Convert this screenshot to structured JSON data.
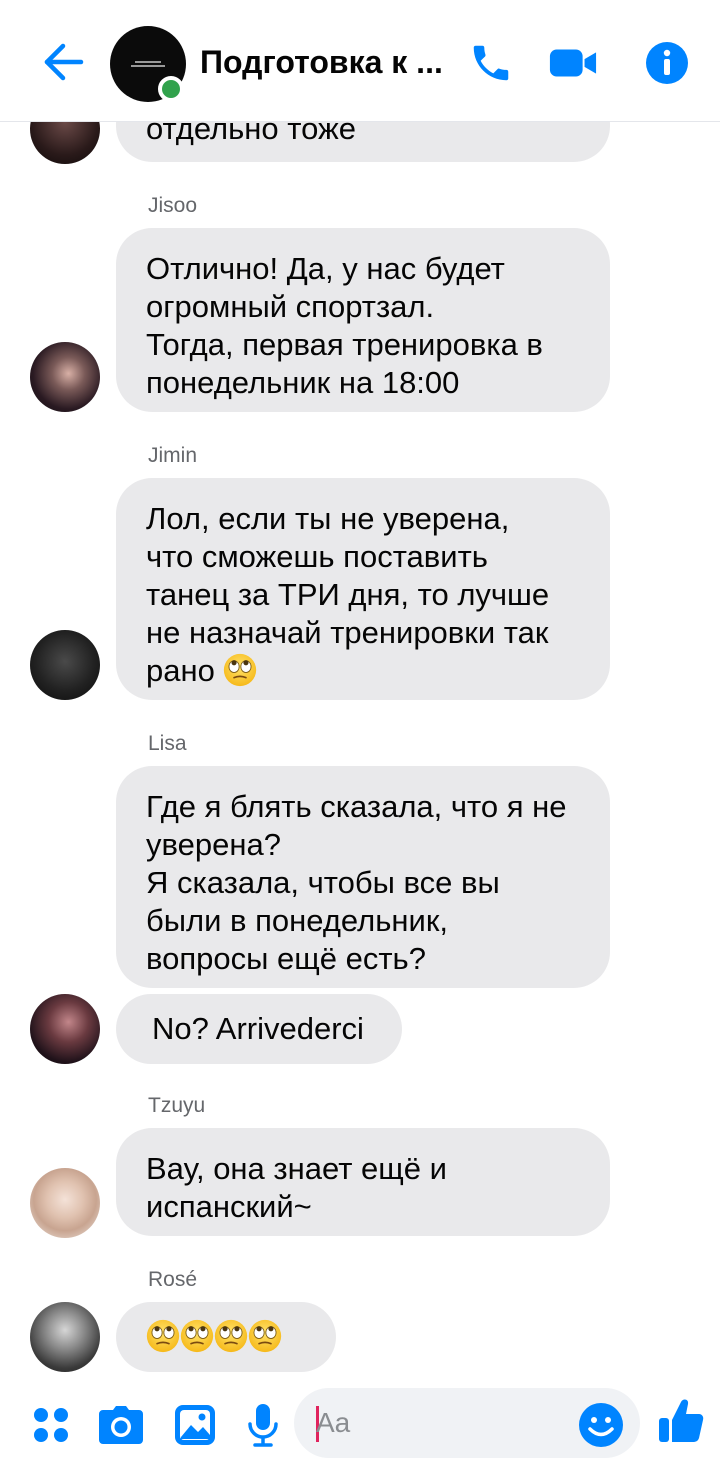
{
  "header": {
    "title": "Подготовка к ...",
    "back_icon": "arrow-left-icon",
    "call_icon": "phone-icon",
    "video_icon": "video-camera-icon",
    "info_icon": "info-icon",
    "accent_color": "#0084ff",
    "online_color": "#31a24c"
  },
  "messages": [
    {
      "sender": "",
      "lines": [
        "отдельно тоже"
      ]
    },
    {
      "sender": "Jisoo",
      "lines": [
        "Отлично! Да, у нас будет",
        "огромный спортзал.",
        "Тогда, первая тренировка в",
        "понедельник на 18:00"
      ]
    },
    {
      "sender": "Jimin",
      "lines": [
        "Лол, если ты не уверена,",
        "что сможешь поставить",
        "танец за ТРИ дня, то лучше",
        "не назначай тренировки так",
        "рано"
      ],
      "trailing_emoji": "rolling-eyes-emoji"
    },
    {
      "sender": "Lisa",
      "lines": [
        "Где я блять сказала, что я не",
        "уверена?",
        "Я сказала, чтобы все вы",
        "были в понедельник,",
        "вопросы ещё есть?"
      ]
    },
    {
      "sender": "",
      "lines": [
        "No? Arrivederci"
      ]
    },
    {
      "sender": "Tzuyu",
      "lines": [
        "Вау, она знает ещё и",
        "испанский~"
      ]
    },
    {
      "sender": "Rosé",
      "lines": [
        ""
      ],
      "emojis": [
        "rolling-eyes-emoji",
        "rolling-eyes-emoji",
        "rolling-eyes-emoji",
        "rolling-eyes-emoji"
      ]
    }
  ],
  "composer": {
    "placeholder": "Aa",
    "icons": [
      "grid-icon",
      "camera-icon",
      "image-icon",
      "microphone-icon",
      "smile-icon",
      "thumbs-up-icon"
    ]
  }
}
